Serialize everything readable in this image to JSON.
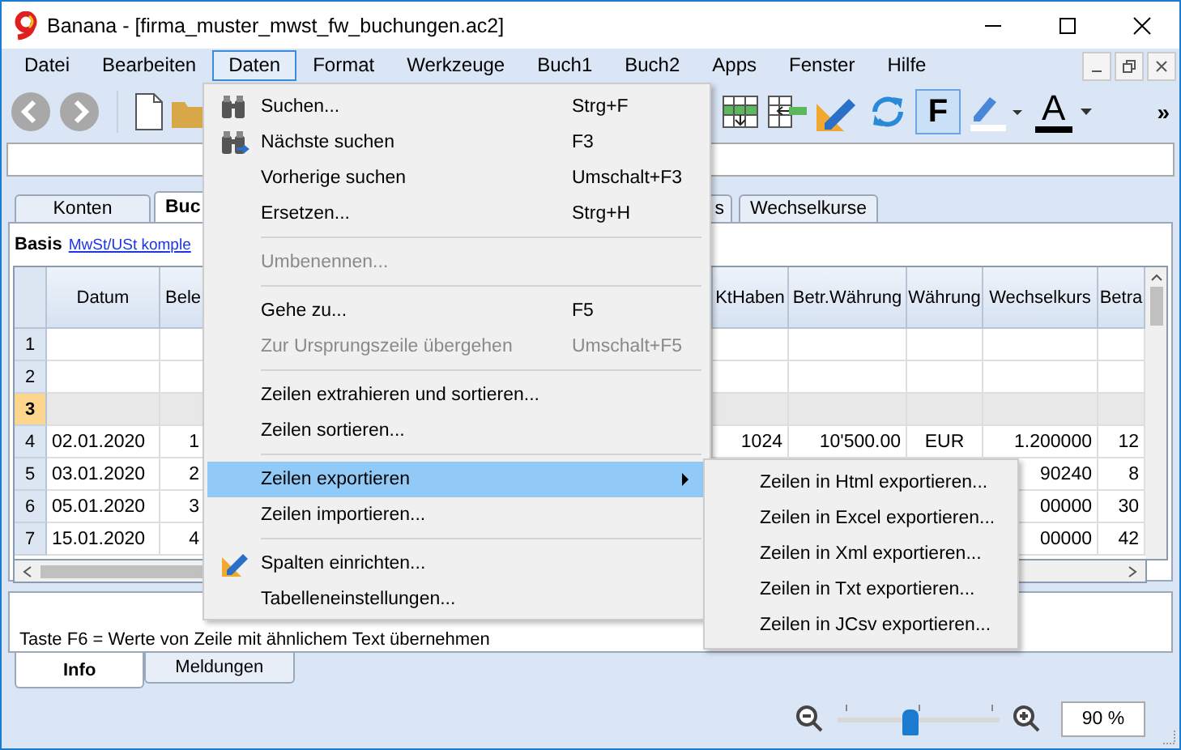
{
  "window": {
    "title": "Banana - [firma_muster_mwst_fw_buchungen.ac2]"
  },
  "menu_bar": [
    {
      "label": "Datei",
      "selected": false
    },
    {
      "label": "Bearbeiten",
      "selected": false
    },
    {
      "label": "Daten",
      "selected": true
    },
    {
      "label": "Format",
      "selected": false
    },
    {
      "label": "Werkzeuge",
      "selected": false
    },
    {
      "label": "Buch1",
      "selected": false
    },
    {
      "label": "Buch2",
      "selected": false
    },
    {
      "label": "Apps",
      "selected": false
    },
    {
      "label": "Fenster",
      "selected": false
    },
    {
      "label": "Hilfe",
      "selected": false
    }
  ],
  "toolbar": {
    "bold_label": "F",
    "bold_active": true,
    "font_color_label": "A",
    "overflow": "»"
  },
  "tabs": [
    {
      "label": "Konten",
      "selected": false
    },
    {
      "label": "Buc",
      "selected": true
    },
    {
      "label": "s",
      "selected": false
    },
    {
      "label": "Wechselkurse",
      "selected": false
    }
  ],
  "basis": {
    "label": "Basis",
    "link": "MwSt/USt komple"
  },
  "table": {
    "columns": [
      "Datum",
      "Bele",
      "KtHaben",
      "Betr.Währung",
      "Währung",
      "Wechselkurs",
      "Betra"
    ],
    "rows": [
      {
        "number": "1",
        "current": false,
        "cells": [
          "",
          "",
          "",
          "",
          "",
          "",
          ""
        ]
      },
      {
        "number": "2",
        "current": false,
        "cells": [
          "",
          "",
          "",
          "",
          "",
          "",
          ""
        ]
      },
      {
        "number": "3",
        "current": true,
        "cells": [
          "",
          "",
          "",
          "",
          "",
          "",
          ""
        ]
      },
      {
        "number": "4",
        "current": false,
        "cells": [
          "02.01.2020",
          "1",
          "1024",
          "10'500.00",
          "EUR",
          "1.200000",
          "12"
        ]
      },
      {
        "number": "5",
        "current": false,
        "cells": [
          "03.01.2020",
          "2",
          "",
          "",
          "",
          "90240",
          "8"
        ]
      },
      {
        "number": "6",
        "current": false,
        "cells": [
          "05.01.2020",
          "3",
          "",
          "",
          "",
          "00000",
          "30"
        ]
      },
      {
        "number": "7",
        "current": false,
        "cells": [
          "15.01.2020",
          "4",
          "",
          "",
          "",
          "00000",
          "42"
        ]
      }
    ]
  },
  "info": {
    "text": "Taste F6 = Werte von Zeile mit ähnlichem Text übernehmen",
    "tabs": [
      {
        "label": "Info",
        "selected": true
      },
      {
        "label": "Meldungen",
        "selected": false
      }
    ]
  },
  "zoom": {
    "level": 0.45,
    "value": "90 %"
  },
  "menu": [
    {
      "kind": "item",
      "label": "Suchen...",
      "shortcut": "Strg+F",
      "disabled": false,
      "selected": false
    },
    {
      "kind": "item",
      "label": "Nächste suchen",
      "shortcut": "F3",
      "disabled": false,
      "selected": false
    },
    {
      "kind": "item",
      "label": "Vorherige suchen",
      "shortcut": "Umschalt+F3",
      "disabled": false,
      "selected": false
    },
    {
      "kind": "item",
      "label": "Ersetzen...",
      "shortcut": "Strg+H",
      "disabled": false,
      "selected": false
    },
    {
      "kind": "separator"
    },
    {
      "kind": "item",
      "label": "Umbenennen...",
      "disabled": true,
      "selected": false
    },
    {
      "kind": "separator"
    },
    {
      "kind": "item",
      "label": "Gehe zu...",
      "shortcut": "F5",
      "disabled": false,
      "selected": false
    },
    {
      "kind": "item",
      "label": "Zur Ursprungszeile übergehen",
      "shortcut": "Umschalt+F5",
      "disabled": true,
      "selected": false
    },
    {
      "kind": "separator"
    },
    {
      "kind": "item",
      "label": "Zeilen extrahieren und sortieren...",
      "disabled": false,
      "selected": false
    },
    {
      "kind": "item",
      "label": "Zeilen sortieren...",
      "disabled": false,
      "selected": false
    },
    {
      "kind": "separator"
    },
    {
      "kind": "submenu",
      "label": "Zeilen exportieren",
      "disabled": false,
      "selected": true,
      "children": [
        "Zeilen in Html exportieren...",
        "Zeilen in Excel exportieren...",
        "Zeilen in Xml exportieren...",
        "Zeilen in Txt exportieren...",
        "Zeilen in JCsv exportieren..."
      ]
    },
    {
      "kind": "item",
      "label": "Zeilen importieren...",
      "disabled": false,
      "selected": false
    },
    {
      "kind": "separator"
    },
    {
      "kind": "item",
      "label": "Spalten einrichten...",
      "disabled": false,
      "selected": false
    },
    {
      "kind": "item",
      "label": "Tabelleneinstellungen...",
      "disabled": false,
      "selected": false
    }
  ]
}
